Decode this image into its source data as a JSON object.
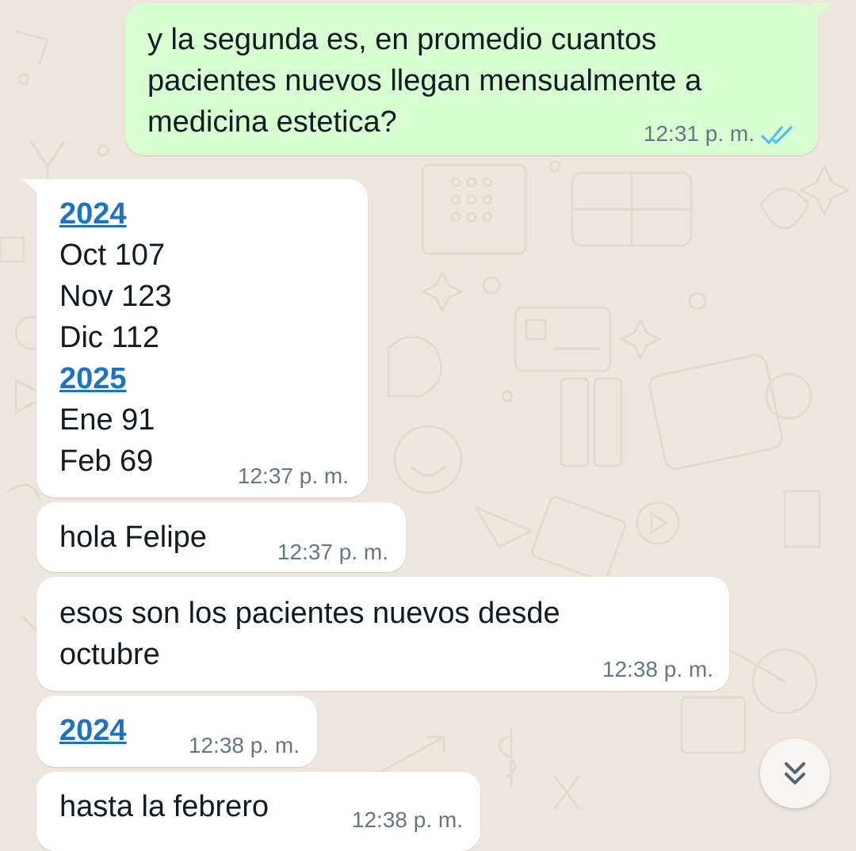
{
  "chat": {
    "messages": [
      {
        "direction": "outgoing",
        "text": "y la segunda es, en promedio cuantos\npacientes nuevos llegan mensualmente a\nmedicina estetica?",
        "time": "12:31 p. m.",
        "status": "read"
      },
      {
        "direction": "incoming",
        "lines": [
          {
            "text": "2024",
            "link": true
          },
          {
            "text": "Oct 107",
            "link": false
          },
          {
            "text": "Nov 123",
            "link": false
          },
          {
            "text": "Dic 112",
            "link": false
          },
          {
            "text": "2025",
            "link": true
          },
          {
            "text": "Ene 91",
            "link": false
          },
          {
            "text": "Feb 69",
            "link": false
          }
        ],
        "time": "12:37 p. m."
      },
      {
        "direction": "incoming",
        "text": "hola Felipe",
        "time": "12:37 p. m."
      },
      {
        "direction": "incoming",
        "text": "esos son los pacientes nuevos desde\noctubre",
        "time": "12:38 p. m."
      },
      {
        "direction": "incoming",
        "text": "2024",
        "link": true,
        "time": "12:38 p. m."
      },
      {
        "direction": "incoming",
        "text": "hasta la febrero",
        "time": "12:38 p. m."
      }
    ],
    "scroll_button_icon": "double-chevron-down-icon"
  },
  "colors": {
    "outgoing_bubble": "#d9fdd3",
    "incoming_bubble": "#ffffff",
    "link": "#1a73c4",
    "read_ticks": "#53bdeb",
    "timestamp": "#667781",
    "background": "#efe7dd"
  }
}
